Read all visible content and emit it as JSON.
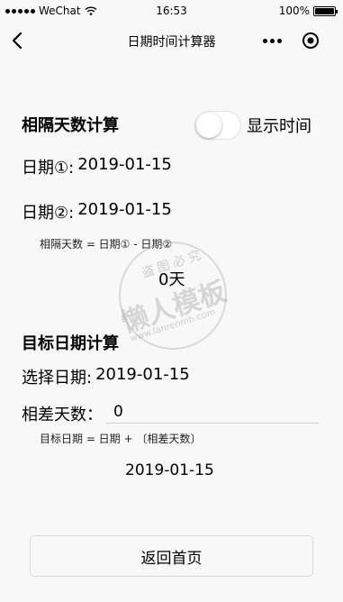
{
  "status_bar": {
    "carrier": "WeChat",
    "time": "16:53",
    "battery": "100%",
    "battery_level": 1.0,
    "signal_bars": 5
  },
  "nav": {
    "title": "日期时间计算器",
    "back_icon": "chevron-left-icon",
    "more_icon": "more-dots-icon",
    "target_icon": "target-circle-icon"
  },
  "interval": {
    "title": "相隔天数计算",
    "toggle_label": "显示时间",
    "toggle_on": false,
    "date1_label": "日期①:",
    "date1_value": "2019-01-15",
    "date2_label": "日期②:",
    "date2_value": "2019-01-15",
    "formula": "相隔天数 = 日期① - 日期②",
    "result": "0天"
  },
  "target": {
    "title": "目标日期计算",
    "select_label": "选择日期:",
    "select_value": "2019-01-15",
    "diff_label": "相差天数：",
    "diff_value": "0",
    "formula": "目标日期 = 日期 + 〔相差天数〕",
    "result": "2019-01-15"
  },
  "back_button_label": "返回首页",
  "watermark": {
    "top": "盗图必究",
    "main": "懒人模板",
    "url": "www.lanrenmb.com"
  },
  "colors": {
    "background": "#f8f8f8",
    "text": "#000000",
    "border": "#d9d9d9"
  }
}
